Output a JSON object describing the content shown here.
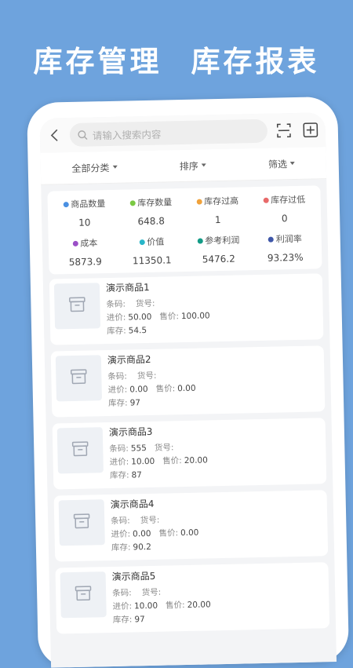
{
  "banner": {
    "left": "库存管理",
    "right": "库存报表"
  },
  "search": {
    "placeholder": "请输入搜索内容"
  },
  "filters": [
    {
      "label": "全部分类"
    },
    {
      "label": "排序"
    },
    {
      "label": "筛选"
    }
  ],
  "stats": [
    {
      "label": "商品数量",
      "value": "10",
      "color": "#4a90e2"
    },
    {
      "label": "库存数量",
      "value": "648.8",
      "color": "#7ac943"
    },
    {
      "label": "库存过高",
      "value": "1",
      "color": "#f0a23b"
    },
    {
      "label": "库存过低",
      "value": "0",
      "color": "#e86a6a"
    },
    {
      "label": "成本",
      "value": "5873.9",
      "color": "#9b4fc7"
    },
    {
      "label": "价值",
      "value": "11350.1",
      "color": "#29b6c9"
    },
    {
      "label": "参考利润",
      "value": "5476.2",
      "color": "#139b86"
    },
    {
      "label": "利润率",
      "value": "93.23%",
      "color": "#3e56a8"
    }
  ],
  "labels": {
    "barcode": "条码:",
    "itemno": "货号:",
    "cost": "进价:",
    "price": "售价:",
    "stock": "库存:"
  },
  "products": [
    {
      "name": "演示商品1",
      "barcode": "",
      "itemno": "",
      "cost": "50.00",
      "price": "100.00",
      "stock": "54.5"
    },
    {
      "name": "演示商品2",
      "barcode": "",
      "itemno": "",
      "cost": "0.00",
      "price": "0.00",
      "stock": "97"
    },
    {
      "name": "演示商品3",
      "barcode": "555",
      "itemno": "",
      "cost": "10.00",
      "price": "20.00",
      "stock": "87"
    },
    {
      "name": "演示商品4",
      "barcode": "",
      "itemno": "",
      "cost": "0.00",
      "price": "0.00",
      "stock": "90.2"
    },
    {
      "name": "演示商品5",
      "barcode": "",
      "itemno": "",
      "cost": "10.00",
      "price": "20.00",
      "stock": "97"
    }
  ]
}
